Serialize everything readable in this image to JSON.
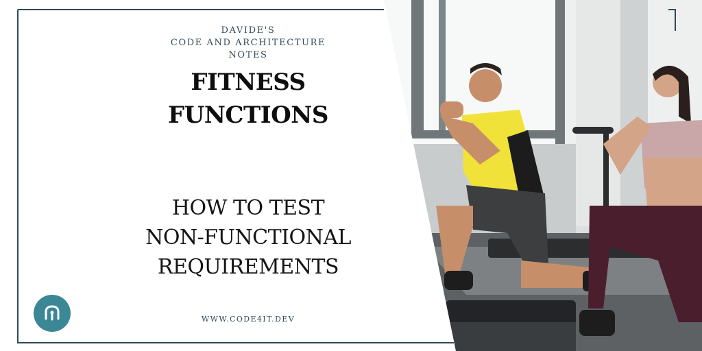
{
  "brand": {
    "line1": "DAVIDE'S",
    "line2": "CODE AND ARCHITECTURE",
    "line3": "NOTES"
  },
  "title": {
    "line1": "FITNESS",
    "line2": "FUNCTIONS"
  },
  "subtitle": {
    "line1": "HOW TO TEST",
    "line2": "NON-FUNCTIONAL",
    "line3": "REQUIREMENTS"
  },
  "website": "WWW.CODE4IT.DEV",
  "logo_icon": "code4it-logo-icon",
  "photo_icon": "fitness-workout-photo",
  "colors": {
    "frame": "#2f4a57",
    "logo": "#3c8796",
    "brand_text": "#334a57"
  }
}
